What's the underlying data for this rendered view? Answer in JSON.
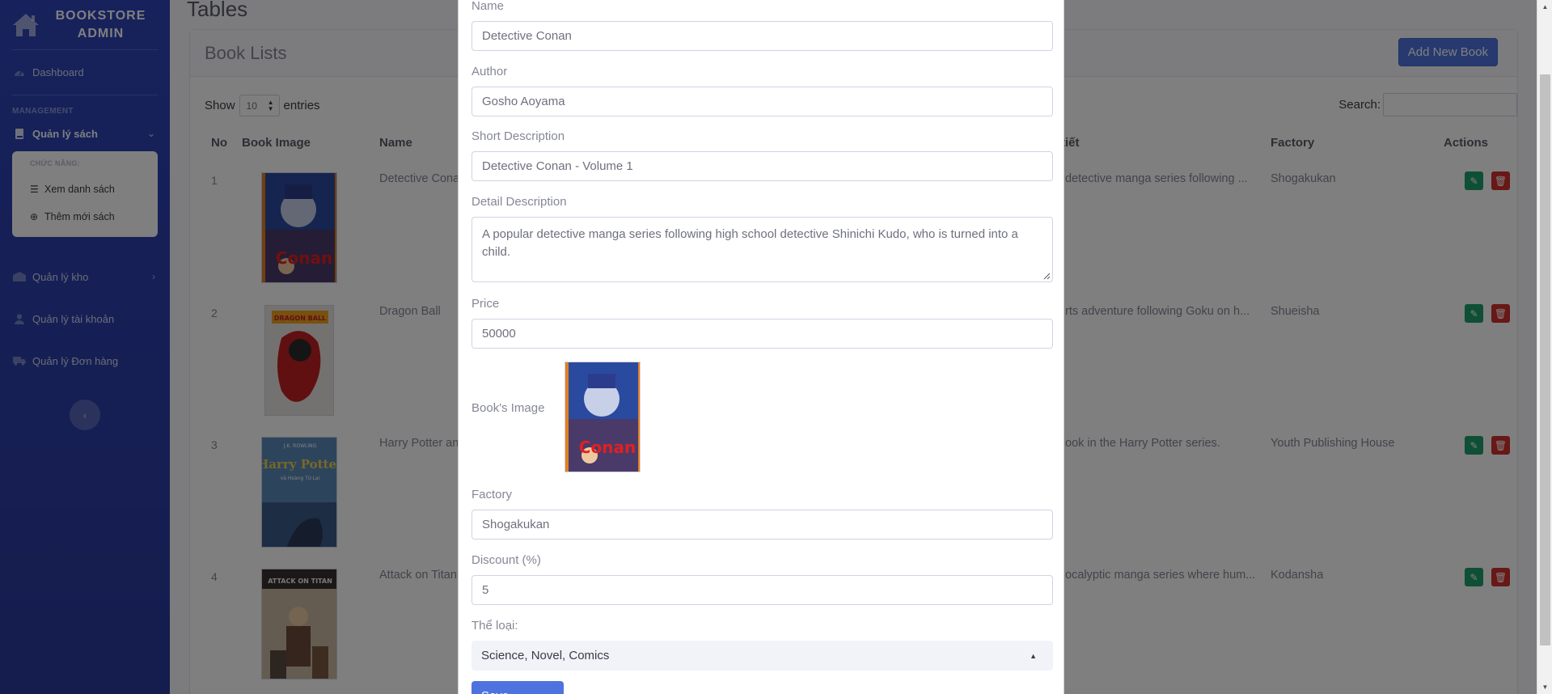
{
  "brand": {
    "line1": "BOOKSTORE",
    "line2": "ADMIN"
  },
  "sidebar": {
    "dashboard": "Dashboard",
    "heading": "MANAGEMENT",
    "books": "Quản lý sách",
    "sub_heading": "CHỨC NĂNG:",
    "sub_list": "Xem danh sách",
    "sub_add": "Thêm mới sách",
    "inventory": "Quản lý kho",
    "accounts": "Quản lý tài khoản",
    "orders": "Quản lý Đơn hàng"
  },
  "page": {
    "title": "Tables",
    "card_title": "Book Lists",
    "add_button": "Add New Book",
    "show_label": "Show",
    "entries_value": "10",
    "entries_label": "entries",
    "search_label": "Search:"
  },
  "table": {
    "headers": {
      "no": "No",
      "image": "Book Image",
      "name": "Name",
      "detail": "tiết",
      "factory": "Factory",
      "actions": "Actions"
    },
    "rows": [
      {
        "no": "1",
        "name": "Detective Cona",
        "detail": "detective manga series following ...",
        "factory": "Shogakukan"
      },
      {
        "no": "2",
        "name": "Dragon Ball",
        "detail": "rts adventure following Goku on h...",
        "factory": "Shueisha"
      },
      {
        "no": "3",
        "name": "Harry Potter an",
        "detail": "ook in the Harry Potter series.",
        "factory": "Youth Publishing House"
      },
      {
        "no": "4",
        "name": "Attack on Titan",
        "detail": "ocalyptic manga series where hum...",
        "factory": "Kodansha"
      }
    ]
  },
  "covers": {
    "conan_title": "Conan",
    "dragonball_title": "DRAGON BALL",
    "hp_author": "J.K. ROWLING",
    "hp_title": "Harry Potter",
    "hp_subtitle": "và Hoàng Tử Lai",
    "aot_title": "ATTACK ON TITAN"
  },
  "modal": {
    "name_label": "Name",
    "name_value": "Detective Conan",
    "author_label": "Author",
    "author_value": "Gosho Aoyama",
    "short_label": "Short Description",
    "short_value": "Detective Conan - Volume 1",
    "detail_label": "Detail Description",
    "detail_value": "A popular detective manga series following high school detective Shinichi Kudo, who is turned into a child.",
    "price_label": "Price",
    "price_value": "50000",
    "image_label": "Book's Image",
    "factory_label": "Factory",
    "factory_value": "Shogakukan",
    "discount_label": "Discount (%)",
    "discount_value": "5",
    "category_label": "Thể loại:",
    "category_value": "Science, Novel, Comics",
    "save_label": "Save changes"
  },
  "colors": {
    "sidebar": "#2e44b8",
    "primary": "#4e73df",
    "edit": "#1e9e6c",
    "delete": "#d0312d"
  },
  "icons": [
    "home-icon",
    "dashboard-icon",
    "book-icon",
    "list-icon",
    "plus-circle-icon",
    "warehouse-icon",
    "user-icon",
    "truck-icon",
    "chevron-left-icon",
    "pencil-icon",
    "trash-icon"
  ]
}
